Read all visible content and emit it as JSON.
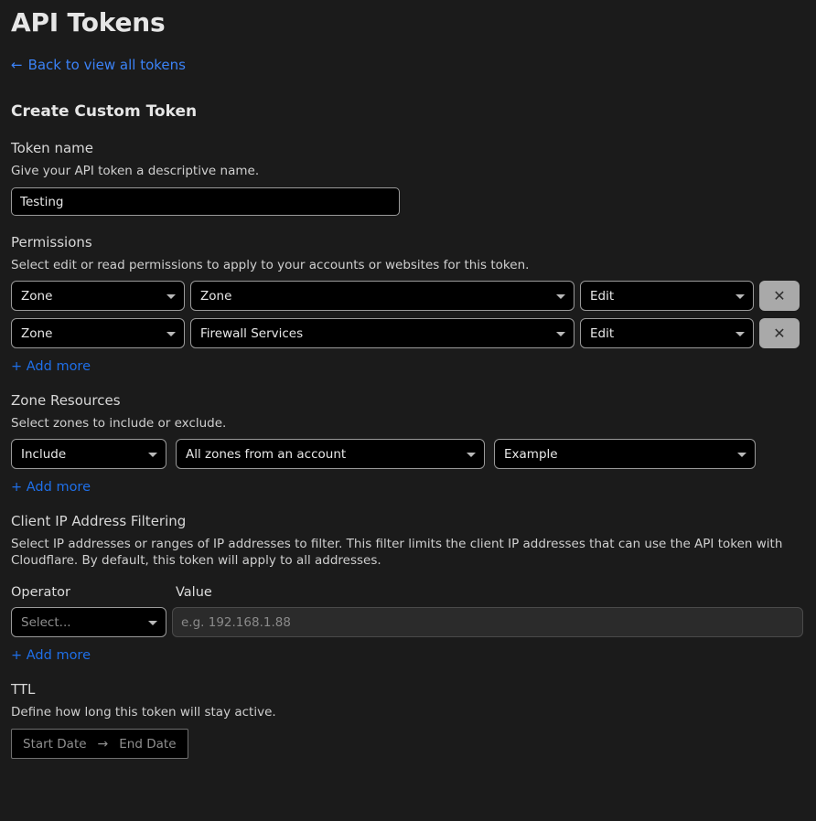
{
  "header": {
    "title": "API Tokens",
    "back_link": "Back to view all tokens",
    "back_arrow_icon": "arrow-left-icon"
  },
  "form": {
    "heading": "Create Custom Token",
    "token_name": {
      "label": "Token name",
      "help": "Give your API token a descriptive name.",
      "value": "Testing",
      "placeholder": ""
    },
    "permissions": {
      "label": "Permissions",
      "help": "Select edit or read permissions to apply to your accounts or websites for this token.",
      "rows": [
        {
          "scope": "Zone",
          "resource": "Zone",
          "access": "Edit",
          "remove_label": "✕"
        },
        {
          "scope": "Zone",
          "resource": "Firewall Services",
          "access": "Edit",
          "remove_label": "✕"
        }
      ],
      "add_more": "+ Add more"
    },
    "zone_resources": {
      "label": "Zone Resources",
      "help": "Select zones to include or exclude.",
      "rows": [
        {
          "mode": "Include",
          "scope": "All zones from an account",
          "account": "Example"
        }
      ],
      "add_more": "+ Add more"
    },
    "client_ip": {
      "label": "Client IP Address Filtering",
      "help": "Select IP addresses or ranges of IP addresses to filter. This filter limits the client IP addresses that can use the API token with Cloudflare. By default, this token will apply to all addresses.",
      "operator_label": "Operator",
      "value_label": "Value",
      "operator_value": "Select...",
      "value_placeholder": "e.g. 192.168.1.88",
      "value_value": "",
      "add_more": "+ Add more"
    },
    "ttl": {
      "label": "TTL",
      "help": "Define how long this token will stay active.",
      "start_date": "Start Date",
      "end_date": "End Date",
      "arrow_icon": "arrow-right-icon"
    }
  },
  "colors": {
    "background": "#1b1b1b",
    "link_blue": "#1f6fe8",
    "back_link_blue": "#3b82f6",
    "input_background": "#000000",
    "remove_button": "#a9a9a9"
  }
}
